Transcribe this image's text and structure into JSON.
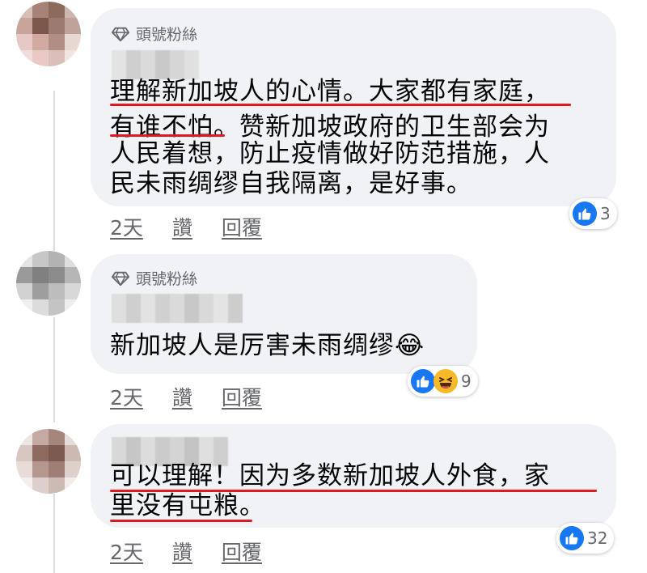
{
  "comments": [
    {
      "badge": "頭號粉絲",
      "line1": "理解新加坡人的心情。大家都有家庭，",
      "line2": "有谁不怕。赞新加坡政府的卫生部会为",
      "line3": "人民着想，防止疫情做好防范措施，人",
      "line4": "民未雨绸缪自我隔离，是好事。",
      "time": "2天",
      "like": "讚",
      "reply": "回覆",
      "reaction_count": "3",
      "reactions": [
        "like-icon"
      ]
    },
    {
      "badge": "頭號粉絲",
      "line1": "新加坡人是厉害未雨绸缪",
      "emoji": "😂",
      "time": "2天",
      "like": "讚",
      "reply": "回覆",
      "reaction_count": "9",
      "reactions": [
        "like-icon",
        "haha-icon"
      ]
    },
    {
      "line1": "可以理解！因为多数新加坡人外食，家",
      "line2": "里没有屯粮。",
      "time": "2天",
      "like": "讚",
      "reply": "回覆",
      "reaction_count": "32",
      "reactions": [
        "like-icon"
      ]
    }
  ],
  "colors": {
    "bubble": "#f0f2f5",
    "like_blue": "#1877f2",
    "underline_red": "#e0191f",
    "meta_gray": "#65676b"
  }
}
